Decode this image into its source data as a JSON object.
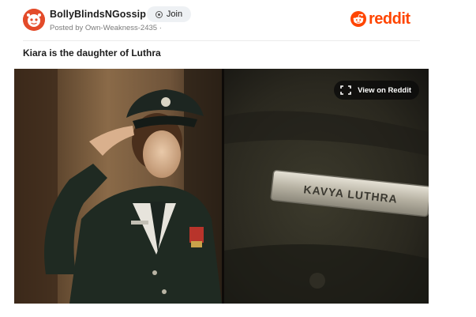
{
  "post": {
    "subreddit": "BollyBlindsNGossip",
    "posted_by": "Posted by Own-Weakness-2435 ·",
    "join_label": "Join",
    "title": "Kiara is the daughter of Luthra"
  },
  "brand": {
    "logo_text": "reddit",
    "accent_color": "#ff4500",
    "avatar_color": "#e34b2a"
  },
  "media": {
    "view_button_label": "View on Reddit",
    "nameplate_text": "KAVYA LUTHRA"
  },
  "icons": {
    "avatar": "subreddit-avatar-icon",
    "join": "join-circle-icon",
    "logo": "reddit-alien-icon",
    "expand": "expand-corners-icon"
  }
}
